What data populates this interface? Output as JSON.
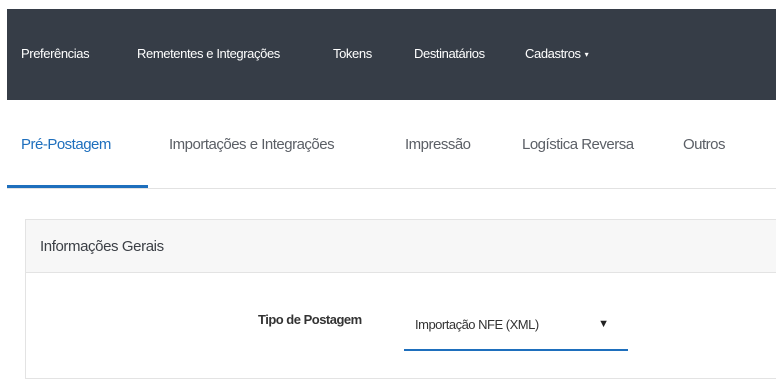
{
  "topnav": {
    "items": [
      {
        "label": "Preferências"
      },
      {
        "label": "Remetentes e Integrações"
      },
      {
        "label": "Tokens"
      },
      {
        "label": "Destinatários"
      },
      {
        "label": "Cadastros"
      }
    ],
    "dropdown_glyph": "▾"
  },
  "tabs": {
    "items": [
      {
        "label": "Pré-Postagem",
        "active": true
      },
      {
        "label": "Importações e Integrações"
      },
      {
        "label": "Impressão"
      },
      {
        "label": "Logística Reversa"
      },
      {
        "label": "Outros"
      }
    ]
  },
  "panel": {
    "title": "Informações Gerais",
    "field": {
      "label": "Tipo de Postagem",
      "value": "Importação NFE (XML)",
      "arrow_glyph": "▼"
    }
  },
  "colors": {
    "nav_bg": "#363d47",
    "accent": "#1e6fbd",
    "panel_header_bg": "#f7f7f7"
  }
}
